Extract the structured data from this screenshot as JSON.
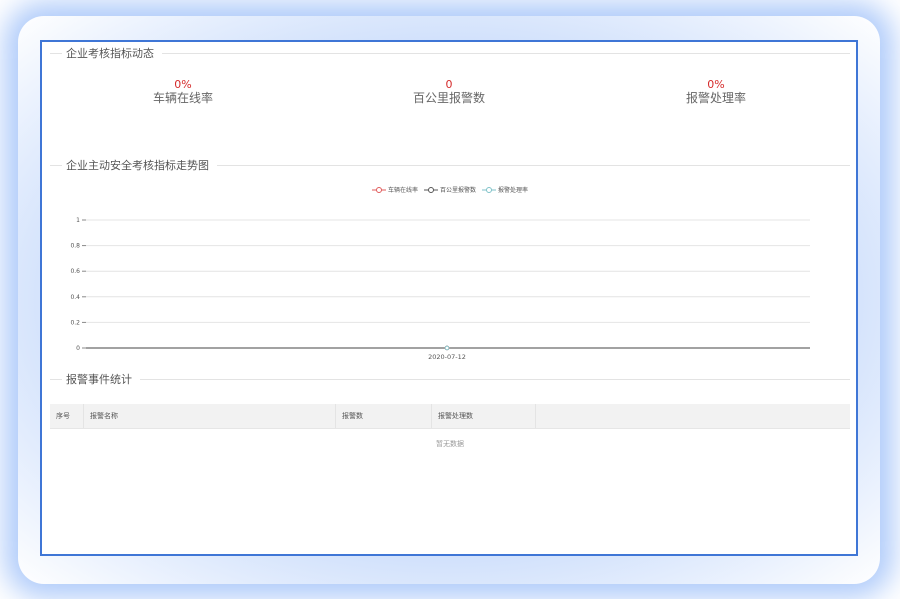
{
  "section1": {
    "title": "企业考核指标动态",
    "kpis": [
      {
        "value": "0%",
        "label": "车辆在线率"
      },
      {
        "value": "0",
        "label": "百公里报警数"
      },
      {
        "value": "0%",
        "label": "报警处理率"
      }
    ]
  },
  "section2": {
    "title": "企业主动安全考核指标走势图"
  },
  "chart_data": {
    "type": "line",
    "categories": [
      "2020-07-12"
    ],
    "series": [
      {
        "name": "车辆在线率",
        "values": [
          0
        ],
        "color": "#e05a5a"
      },
      {
        "name": "百公里报警数",
        "values": [
          0
        ],
        "color": "#555555"
      },
      {
        "name": "报警处理率",
        "values": [
          0
        ],
        "color": "#7fc2c8"
      }
    ],
    "ylim": [
      0,
      1
    ],
    "yticks": [
      "1",
      "0.8",
      "0.6",
      "0.4",
      "0.2",
      "0"
    ],
    "grid": true,
    "legend": "top-center"
  },
  "section3": {
    "title": "报警事件统计",
    "columns": [
      "序号",
      "报警名称",
      "报警数",
      "报警处理数",
      ""
    ],
    "empty_text": "暂无数据"
  }
}
